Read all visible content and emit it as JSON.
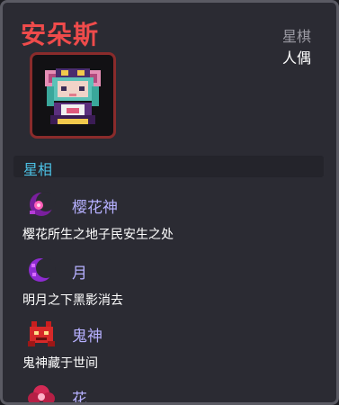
{
  "character": {
    "name": "安朵斯",
    "category_top": "星棋",
    "category": "人偶"
  },
  "section": {
    "title": "星相"
  },
  "skills": [
    {
      "name": "樱花神",
      "desc": "樱花所生之地子民安生之处",
      "icon": "sakura-moon-icon"
    },
    {
      "name": "月",
      "desc": "明月之下黑影消去",
      "icon": "crescent-moon-icon"
    },
    {
      "name": "鬼神",
      "desc": "鬼神藏于世间",
      "icon": "demon-icon"
    },
    {
      "name": "花",
      "desc": "",
      "icon": "flower-icon"
    }
  ],
  "colors": {
    "title": "#ef4b4b",
    "section": "#4cc2e6",
    "skill_name": "#b6b0ff",
    "panel": "#2b2b33",
    "border": "#5a5a63"
  }
}
